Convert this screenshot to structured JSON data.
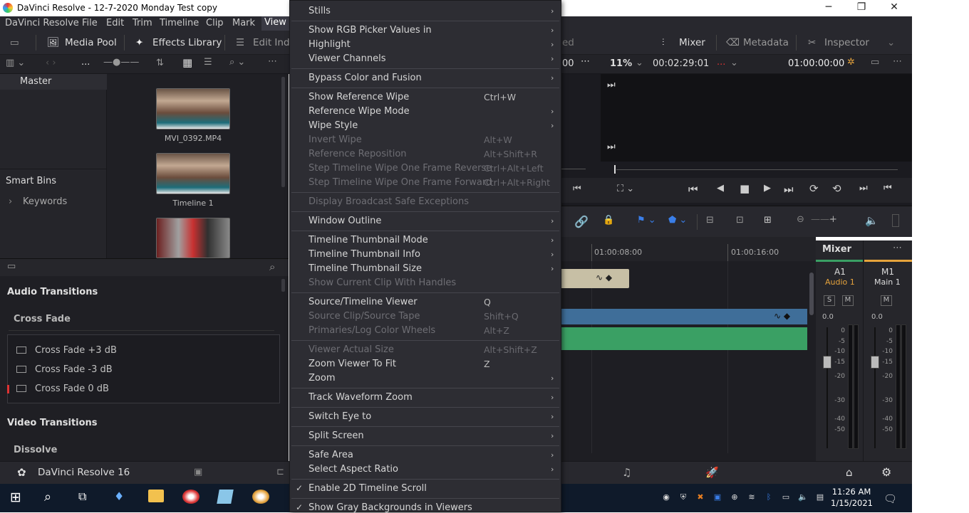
{
  "window": {
    "title": "DaVinci Resolve - 12-7-2020 Monday Test copy",
    "minimize": "─",
    "maximize": "❐",
    "close": "✕"
  },
  "menubar": [
    "DaVinci Resolve",
    "File",
    "Edit",
    "Trim",
    "Timeline",
    "Clip",
    "Mark",
    "View"
  ],
  "toolbar": {
    "media_pool": "Media Pool",
    "effects_library": "Effects Library",
    "edit_index": "Edit Inde",
    "partial_ed": "ed",
    "mixer": "Mixer",
    "metadata": "Metadata",
    "inspector": "Inspector"
  },
  "subbar": {
    "ellipsis": "...",
    "timecode_left": "00",
    "zoom": "11%",
    "duration": "00:02:29:01",
    "viewer_mode": "...",
    "timecode": "01:00:00:00"
  },
  "bins": {
    "master": "Master",
    "smart_bins": "Smart Bins",
    "keywords": "Keywords"
  },
  "clips": [
    {
      "name": "MVI_0392.MP4"
    },
    {
      "name": "Timeline 1"
    }
  ],
  "effects": {
    "audio_transitions": "Audio Transitions",
    "cross_fade": "Cross Fade",
    "items": [
      "Cross Fade +3 dB",
      "Cross Fade -3 dB",
      "Cross Fade 0 dB"
    ],
    "video_transitions": "Video Transitions",
    "dissolve": "Dissolve"
  },
  "timeline": {
    "ruler": [
      "01:00:08:00",
      "01:00:16:00"
    ]
  },
  "mixer": {
    "title": "Mixer",
    "a1": "A1",
    "m1": "M1",
    "audio1": "Audio 1",
    "main1": "Main 1",
    "s": "S",
    "m": "M",
    "db_a": "0.0",
    "db_m": "0.0",
    "scale": [
      "0",
      "-5",
      "-10",
      "-15",
      "-20",
      "-30",
      "-40",
      "-50"
    ]
  },
  "bottombar": {
    "app": "DaVinci Resolve 16"
  },
  "clock": {
    "time": "11:26 AM",
    "date": "1/15/2021"
  },
  "menu": {
    "stills": "Stills",
    "rgb_picker": "Show RGB Picker Values in",
    "highlight": "Highlight",
    "viewer_channels": "Viewer Channels",
    "bypass": "Bypass Color and Fusion",
    "show_ref_wipe": "Show Reference Wipe",
    "show_ref_wipe_sc": "Ctrl+W",
    "ref_wipe_mode": "Reference Wipe Mode",
    "wipe_style": "Wipe Style",
    "invert_wipe": "Invert Wipe",
    "invert_wipe_sc": "Alt+W",
    "ref_reposition": "Reference Reposition",
    "ref_reposition_sc": "Alt+Shift+R",
    "step_rev": "Step Timeline Wipe One Frame Reverse",
    "step_rev_sc": "Ctrl+Alt+Left",
    "step_fwd": "Step Timeline Wipe One Frame Forward",
    "step_fwd_sc": "Ctrl+Alt+Right",
    "broadcast": "Display Broadcast Safe Exceptions",
    "window_outline": "Window Outline",
    "thumb_mode": "Timeline Thumbnail Mode",
    "thumb_info": "Timeline Thumbnail Info",
    "thumb_size": "Timeline Thumbnail Size",
    "handles": "Show Current Clip With Handles",
    "source_timeline": "Source/Timeline Viewer",
    "source_timeline_sc": "Q",
    "source_clip": "Source Clip/Source Tape",
    "source_clip_sc": "Shift+Q",
    "primaries": "Primaries/Log Color Wheels",
    "primaries_sc": "Alt+Z",
    "actual_size": "Viewer Actual Size",
    "actual_size_sc": "Alt+Shift+Z",
    "zoom_fit": "Zoom Viewer To Fit",
    "zoom_fit_sc": "Z",
    "zoom": "Zoom",
    "waveform_zoom": "Track Waveform Zoom",
    "switch_eye": "Switch Eye to",
    "split_screen": "Split Screen",
    "safe_area": "Safe Area",
    "aspect_ratio": "Select Aspect Ratio",
    "enable_2d": "Enable 2D Timeline Scroll",
    "gray_bg": "Show Gray Backgrounds in Viewers"
  }
}
